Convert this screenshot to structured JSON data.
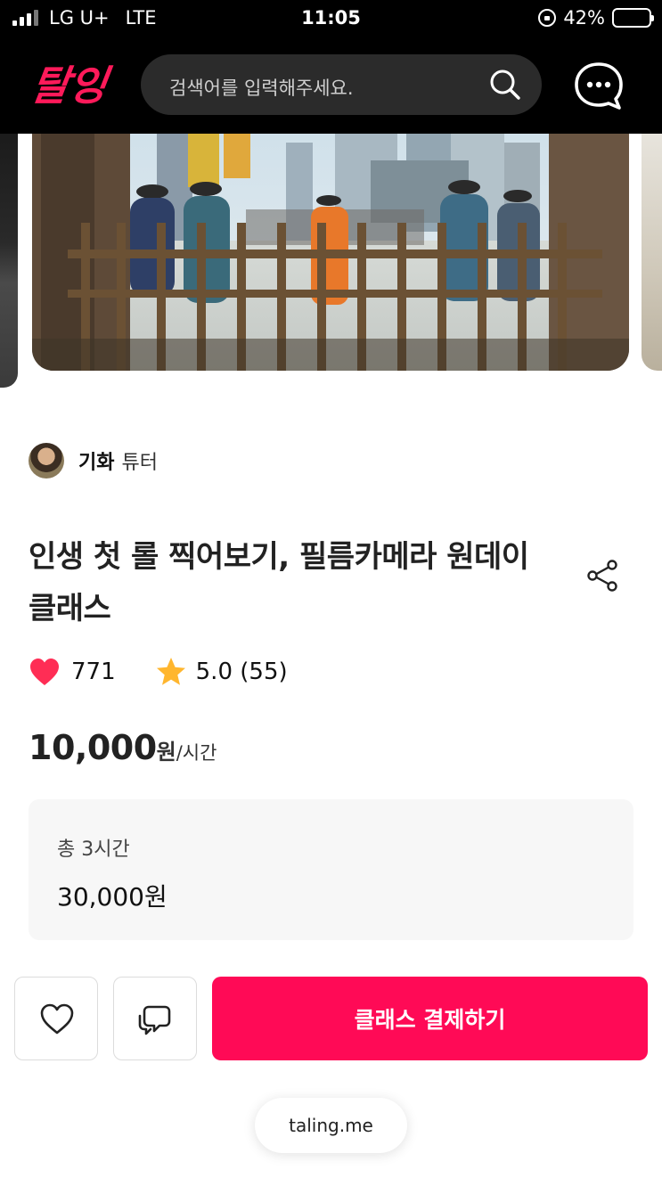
{
  "status_bar": {
    "carrier": "LG U+",
    "network": "LTE",
    "time": "11:05",
    "battery": "42%",
    "battery_level": 0.42
  },
  "header": {
    "logo_text": "탈잉",
    "search_placeholder": "검색어를 입력해주세요.",
    "icons": [
      "search-icon",
      "chat-bubble-icon"
    ],
    "brand_color": "#ff1a5a"
  },
  "tutor": {
    "name": "기화",
    "suffix": "튜터"
  },
  "class": {
    "title": "인생 첫 롤 찍어보기, 필름카메라 원데이 클래스",
    "likes": "771",
    "rating": "5.0 (55)",
    "price_value": "10,000",
    "price_won": "원",
    "price_unit": "/시간"
  },
  "total": {
    "label": "총 3시간",
    "value": "30,000원"
  },
  "actions": {
    "pay_label": "클래스 결제하기",
    "pay_color": "#ff0a56",
    "icons": [
      "heart-outline-icon",
      "message-icon"
    ]
  },
  "browser": {
    "url": "taling.me"
  }
}
